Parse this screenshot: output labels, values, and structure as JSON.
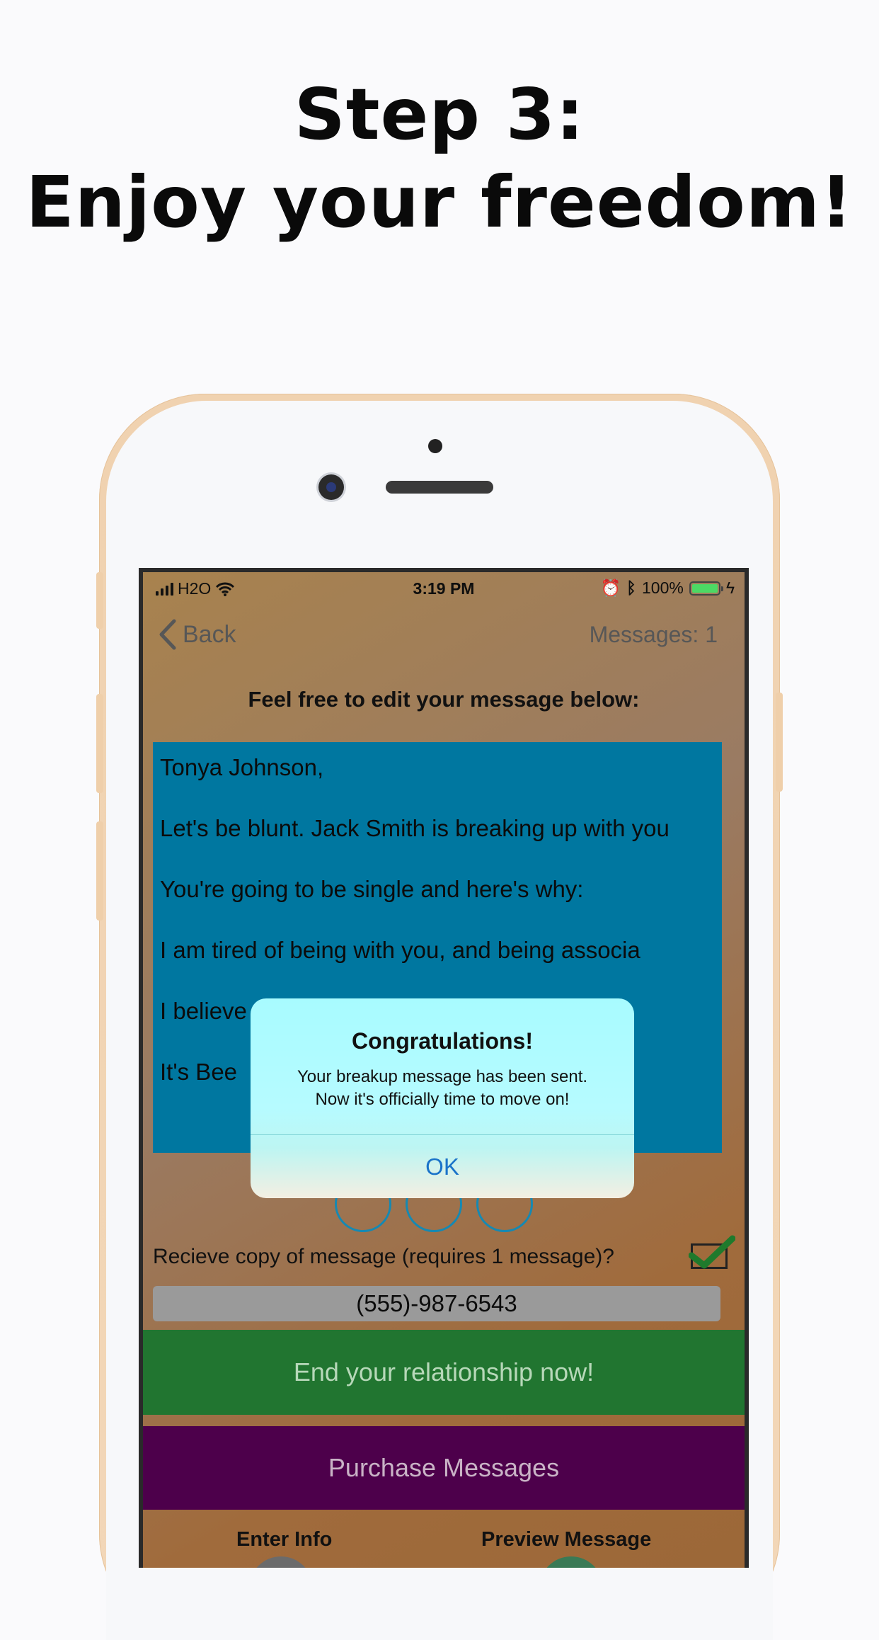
{
  "headline": {
    "line1": "Step 3:",
    "line2": "Enjoy your freedom!"
  },
  "status_bar": {
    "carrier": "H2O",
    "time": "3:19 PM",
    "battery": "100%"
  },
  "nav": {
    "back_label": "Back",
    "messages_count": "Messages: 1"
  },
  "prompt": "Feel free to edit your message below:",
  "message": {
    "paragraphs": [
      "Tonya Johnson,",
      "Let's be blunt. Jack Smith is breaking up with you",
      "You're going to be single and here's why:",
      "I am tired of being with you, and being associa",
      "I believe                                      stairs.",
      "It's Bee"
    ]
  },
  "copy_option": {
    "label": "Recieve copy of message (requires 1 message)?",
    "checked": true
  },
  "phone_number": "(555)-987-6543",
  "buttons": {
    "end": "End your relationship now!",
    "purchase": "Purchase Messages"
  },
  "tabs": {
    "left": "Enter Info",
    "right": "Preview Message"
  },
  "alert": {
    "title": "Congratulations!",
    "message_line1": "Your breakup message has been sent.",
    "message_line2": "Now it's officially time to move on!",
    "ok": "OK"
  },
  "colors": {
    "message_bg": "#0077a0",
    "end_button": "#217530",
    "purchase_button": "#4d004b",
    "alert_bg": "#a8fbff",
    "link_blue": "#1a73c9"
  }
}
